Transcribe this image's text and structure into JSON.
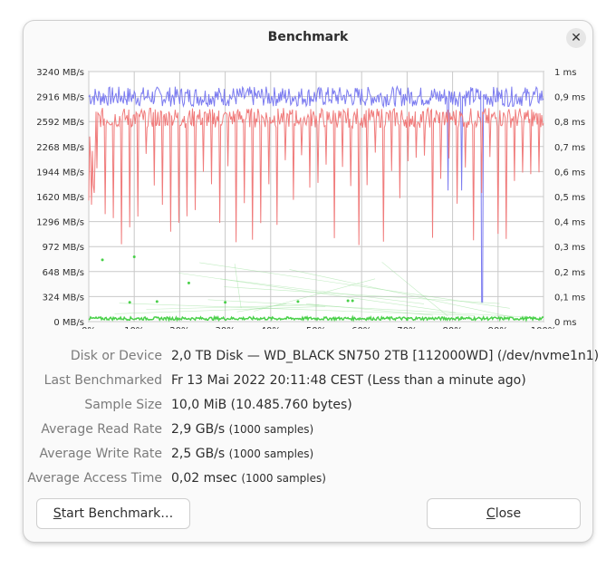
{
  "window": {
    "title": "Benchmark",
    "close_icon": "close-icon"
  },
  "chart_data": {
    "type": "line",
    "title": "",
    "left_axis": [
      "3240 MB/s",
      "2916 MB/s",
      "2592 MB/s",
      "2268 MB/s",
      "1944 MB/s",
      "1620 MB/s",
      "1296 MB/s",
      "972 MB/s",
      "648 MB/s",
      "324 MB/s",
      "0 MB/s"
    ],
    "right_axis": [
      "1 ms",
      "0,9 ms",
      "0,8 ms",
      "0,7 ms",
      "0,6 ms",
      "0,5 ms",
      "0,4 ms",
      "0,3 ms",
      "0,2 ms",
      "0,1 ms",
      "0 ms"
    ],
    "x_axis": [
      "0%",
      "10%",
      "20%",
      "30%",
      "40%",
      "50%",
      "60%",
      "70%",
      "80%",
      "90%",
      "100%"
    ],
    "ylim": [
      0,
      3240
    ],
    "y2lim": [
      0,
      1
    ],
    "xlim": [
      0,
      100
    ],
    "grid": true,
    "series": [
      {
        "color": "#7b7bf0",
        "avg": 2916
      },
      {
        "color": "#f07b7b",
        "avg": 2592
      },
      {
        "color": "#49d049",
        "avg": 0.02
      }
    ]
  },
  "info": {
    "device_label": "Disk or Device",
    "device_value": "2,0 TB Disk — WD_BLACK  SN750 2TB [112000WD] (/dev/nvme1n1)",
    "last_label": "Last Benchmarked",
    "last_value": "Fr 13 Mai 2022 20:11:48 CEST (Less than a minute ago)",
    "sample_label": "Sample Size",
    "sample_value": "10,0 MiB (10.485.760 bytes)",
    "read_label": "Average Read Rate",
    "read_value": "2,9 GB/s",
    "read_samples": "(1000 samples)",
    "write_label": "Average Write Rate",
    "write_value": "2,5 GB/s",
    "write_samples": "(1000 samples)",
    "access_label": "Average Access Time",
    "access_value": "0,02 msec",
    "access_samples": "(1000 samples)"
  },
  "buttons": {
    "start_first": "S",
    "start_rest": "tart Benchmark…",
    "close_first": "C",
    "close_rest": "lose"
  }
}
